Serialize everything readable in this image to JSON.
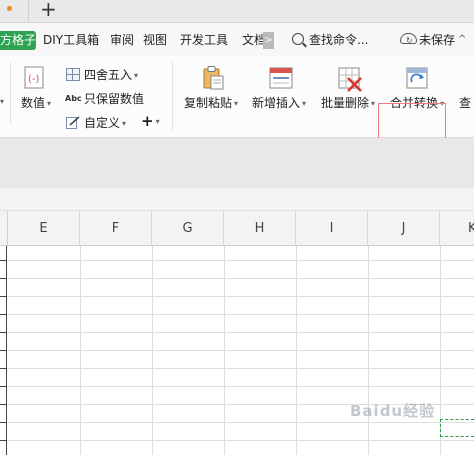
{
  "tabs": {
    "new_tab_label": "+"
  },
  "menu": {
    "active_tab": "方格子",
    "items": [
      "DIY工具箱",
      "审阅",
      "视图",
      "开发工具",
      "文档"
    ],
    "more_label": ">",
    "search_label": "查找命令...",
    "unsaved_label": "未保存",
    "collapse_label": "^"
  },
  "ribbon": {
    "number_label": "数值",
    "round_label": "四舍五入",
    "keep_value_label": "只保留数值",
    "custom_label": "自定义",
    "plus_label": "+",
    "copy_paste_label": "复制粘贴",
    "insert_label": "新增插入",
    "batch_delete_label": "批量删除",
    "merge_convert_label": "合并转换",
    "partial_label": "查"
  },
  "sheet": {
    "columns": [
      "E",
      "F",
      "G",
      "H",
      "I",
      "J",
      "K"
    ]
  },
  "watermark": "Baidu经验",
  "colors": {
    "accent_green": "#2ea352",
    "highlight_red": "#f07a7a",
    "selection_dash": "#2e9c45"
  }
}
